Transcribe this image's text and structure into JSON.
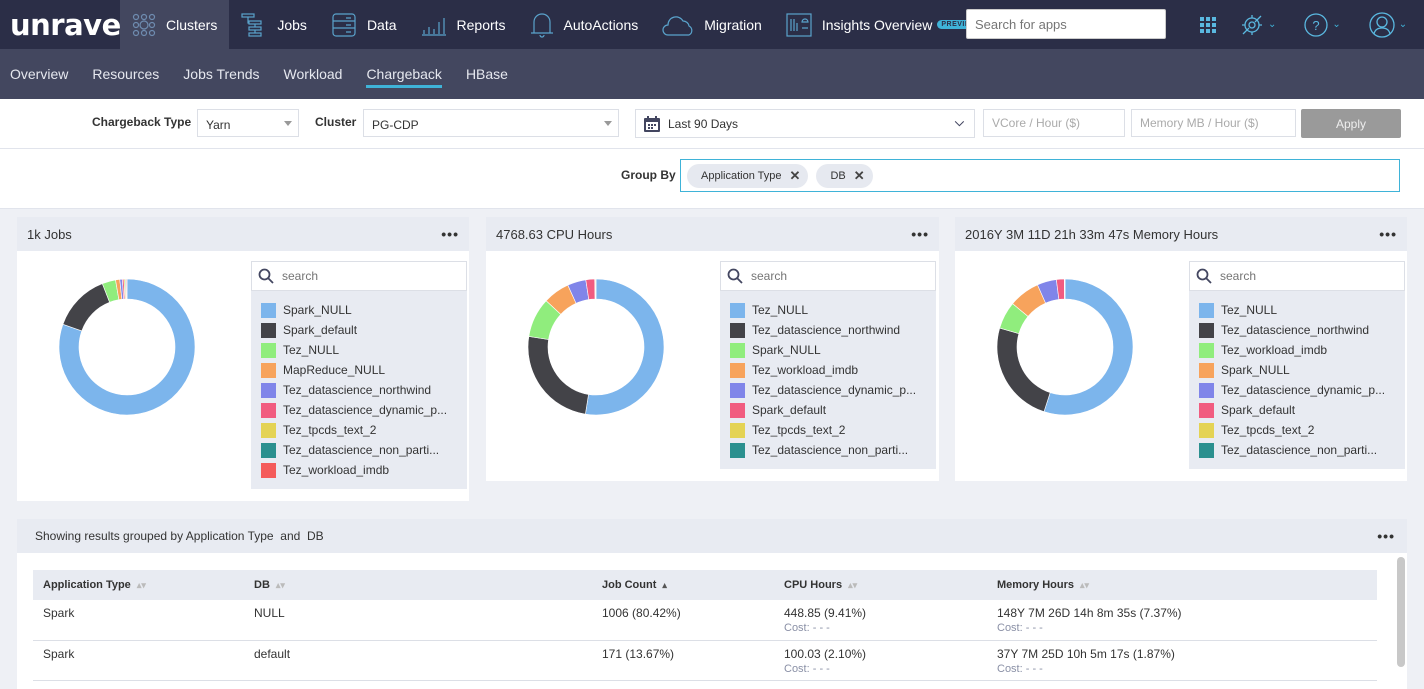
{
  "topnav": {
    "logo": "unravel",
    "items": [
      {
        "label": "Clusters",
        "icon": "clusters-icon",
        "active": true
      },
      {
        "label": "Jobs",
        "icon": "jobs-icon"
      },
      {
        "label": "Data",
        "icon": "data-icon"
      },
      {
        "label": "Reports",
        "icon": "reports-icon"
      },
      {
        "label": "AutoActions",
        "icon": "bell-icon"
      },
      {
        "label": "Migration",
        "icon": "cloud-icon"
      },
      {
        "label": "Insights Overview",
        "icon": "insights-icon",
        "badge": "PREVIEW"
      }
    ],
    "search_placeholder": "Search for apps"
  },
  "subnav": {
    "items": [
      "Overview",
      "Resources",
      "Jobs Trends",
      "Workload",
      "Chargeback",
      "HBase"
    ],
    "active": "Chargeback"
  },
  "filters": {
    "chargeback_type_label": "Chargeback Type",
    "chargeback_type_value": "Yarn",
    "cluster_label": "Cluster",
    "cluster_value": "PG-CDP",
    "date_range": "Last 90 Days",
    "vcore_placeholder": "VCore / Hour ($)",
    "memory_placeholder": "Memory MB / Hour ($)",
    "apply_label": "Apply"
  },
  "group_by": {
    "label": "Group By",
    "chips": [
      "Application Type",
      "DB"
    ]
  },
  "colors": {
    "accent": "#3fb3d8",
    "nav_bg": "#2b2e47",
    "subnav_bg": "#43475f"
  },
  "chart_data": [
    {
      "type": "pie",
      "title": "1k Jobs",
      "search_placeholder": "search",
      "labels": [
        "Spark_NULL",
        "Spark_default",
        "Tez_NULL",
        "MapReduce_NULL",
        "Tez_datascience_northwind",
        "Tez_datascience_dynamic_p...",
        "Tez_tpcds_text_2",
        "Tez_datascience_non_parti...",
        "Tez_workload_imdb"
      ],
      "colors": [
        "#7cb5ec",
        "#434348",
        "#90ed7d",
        "#f7a35c",
        "#8085e9",
        "#f15c80",
        "#e4d354",
        "#2b908f",
        "#f45b5b"
      ],
      "values": [
        80.42,
        13.67,
        3.2,
        1.0,
        0.6,
        0.4,
        0.3,
        0.2,
        0.2
      ]
    },
    {
      "type": "pie",
      "title": "4768.63 CPU Hours",
      "search_placeholder": "search",
      "labels": [
        "Tez_NULL",
        "Tez_datascience_northwind",
        "Spark_NULL",
        "Tez_workload_imdb",
        "Tez_datascience_dynamic_p...",
        "Spark_default",
        "Tez_tpcds_text_2",
        "Tez_datascience_non_parti..."
      ],
      "colors": [
        "#7cb5ec",
        "#434348",
        "#90ed7d",
        "#f7a35c",
        "#8085e9",
        "#f15c80",
        "#e4d354",
        "#2b908f"
      ],
      "values": [
        52.5,
        25.0,
        9.41,
        6.3,
        4.4,
        2.1,
        0.2,
        0.1
      ]
    },
    {
      "type": "pie",
      "title": "2016Y 3M 11D 21h 33m 47s Memory Hours",
      "search_placeholder": "search",
      "labels": [
        "Tez_NULL",
        "Tez_datascience_northwind",
        "Tez_workload_imdb",
        "Spark_NULL",
        "Tez_datascience_dynamic_p...",
        "Spark_default",
        "Tez_tpcds_text_2",
        "Tez_datascience_non_parti..."
      ],
      "colors": [
        "#7cb5ec",
        "#434348",
        "#90ed7d",
        "#f7a35c",
        "#8085e9",
        "#f15c80",
        "#e4d354",
        "#2b908f"
      ],
      "values": [
        55.0,
        24.5,
        6.5,
        7.37,
        4.6,
        1.87,
        0.1,
        0.06
      ]
    }
  ],
  "table": {
    "caption": "Showing results grouped by Application Type  and  DB",
    "columns": [
      "Application Type",
      "DB",
      "Job Count",
      "CPU Hours",
      "Memory Hours"
    ],
    "sorted_column": "Job Count",
    "rows": [
      {
        "app_type": "Spark",
        "db": "NULL",
        "job_count": "1006 (80.42%)",
        "cpu_hours": "448.85 (9.41%)",
        "cpu_cost": "Cost: - - -",
        "memory_hours": "148Y 7M 26D 14h 8m 35s (7.37%)",
        "memory_cost": "Cost: - - -"
      },
      {
        "app_type": "Spark",
        "db": "default",
        "job_count": "171 (13.67%)",
        "cpu_hours": "100.03 (2.10%)",
        "cpu_cost": "Cost: - - -",
        "memory_hours": "37Y 7M 25D 10h 5m 17s (1.87%)",
        "memory_cost": "Cost: - - -"
      }
    ]
  }
}
